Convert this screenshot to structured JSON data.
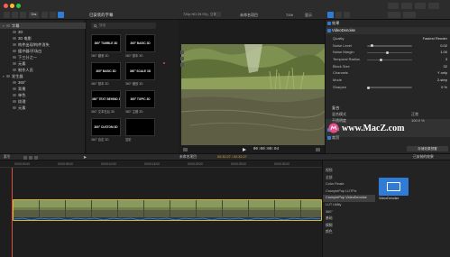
{
  "toolbar": {
    "media_badge": "0ns",
    "browser_title": "已安装的字幕",
    "viewer_info": "720p HD 29.97p, 立体声",
    "clip_title": "未命名项目",
    "zoom": "71%",
    "view_menu": "显示"
  },
  "library": {
    "items": [
      {
        "label": "字幕",
        "level": 0,
        "selected": true,
        "expanded": true
      },
      {
        "label": "3D",
        "level": 1
      },
      {
        "label": "3D 电影",
        "level": 1
      },
      {
        "label": "构件出现/构件消失",
        "level": 1
      },
      {
        "label": "缓冲器/开场白",
        "level": 1
      },
      {
        "label": "下三分之一",
        "level": 1
      },
      {
        "label": "元素",
        "level": 1
      },
      {
        "label": "制作人员",
        "level": 1
      },
      {
        "label": "发生器",
        "level": 0,
        "expanded": true
      },
      {
        "label": "360°",
        "level": 1
      },
      {
        "label": "背景",
        "level": 1
      },
      {
        "label": "单色",
        "level": 1
      },
      {
        "label": "纹理",
        "level": 1
      },
      {
        "label": "元素",
        "level": 1
      }
    ]
  },
  "browser": {
    "search_placeholder": "搜索",
    "thumbs": [
      {
        "title": "360° TUMBLE 3D",
        "label": "360° 翻滚 3D"
      },
      {
        "title": "360° BASIC 3D",
        "label": "360° 基本 3D"
      },
      {
        "title": "360° BASIC 3D",
        "label": "360° 基本 3D"
      },
      {
        "title": "360° SCALE 3D",
        "label": "360° 缩放 3D"
      },
      {
        "title": "360° TEXT BEHIND 3D",
        "label": "360° 文本在后 3D"
      },
      {
        "title": "360° TOPIC 3D",
        "label": "360° 主题 3D"
      },
      {
        "title": "360° CUSTOM 3D",
        "label": "360° 自定 3D"
      },
      {
        "title": "",
        "label": "显影"
      }
    ]
  },
  "viewer": {
    "timecode": "00:00:00:04"
  },
  "inspector": {
    "section_title": "效果",
    "effect_name": "VideoDenoise",
    "params": [
      {
        "label": "Quality",
        "value": "Fastest Render",
        "type": "select"
      },
      {
        "label": "Noise Level",
        "value": "0.02",
        "type": "slider",
        "level": 0.08
      },
      {
        "label": "Noise Margin",
        "value": "1.00",
        "type": "slider",
        "level": 0.45
      },
      {
        "label": "Temporal Radius",
        "value": "3",
        "type": "slider",
        "level": 0.3
      },
      {
        "label": "Block Size",
        "value": "32",
        "type": "select"
      },
      {
        "label": "Channels",
        "value": "Y only",
        "type": "select"
      },
      {
        "label": "Mode",
        "value": "2-step",
        "type": "select"
      },
      {
        "label": "Sharpen",
        "value": "0 %",
        "type": "slider",
        "level": 0.0
      }
    ],
    "compositing_title": "复合",
    "blend_mode_label": "混合模式",
    "blend_mode_value": "正常",
    "opacity_label": "不透明度",
    "opacity_value": "100.0 %",
    "transform_label": "变换",
    "crop_label": "裁剪",
    "save_effects_label": "存储效果预置"
  },
  "timeline": {
    "index_label": "索引",
    "project_name": "未命名项目",
    "timecode": "00:32:27 / 02:32:27",
    "ruler": [
      "00:00:00:00",
      "00:00:05:00",
      "00:00:10:00",
      "00:00:15:00",
      "00:00:20:00",
      "00:00:25:00",
      "00:00:30:00"
    ]
  },
  "effects_browser": {
    "title": "已安装的效果",
    "categories": [
      {
        "label": "视频"
      },
      {
        "label": "全部"
      },
      {
        "label": "Color Finale"
      },
      {
        "label": "CrumplePop LUTFix"
      },
      {
        "label": "CrumplePop VideoDenoise",
        "selected": true
      },
      {
        "label": "LUT Utility"
      },
      {
        "label": "360°"
      },
      {
        "label": "基础"
      },
      {
        "label": "模糊"
      },
      {
        "label": "颜色"
      }
    ],
    "effect_thumb_label": "VideoDenoise"
  },
  "watermark": {
    "text": "www.MacZ.com",
    "icon": "macz-logo-icon"
  },
  "colors": {
    "accent": "#2f7bd6",
    "clip_border": "#d5b532",
    "playhead": "#e24a3a",
    "timecode": "#e0a33a"
  }
}
